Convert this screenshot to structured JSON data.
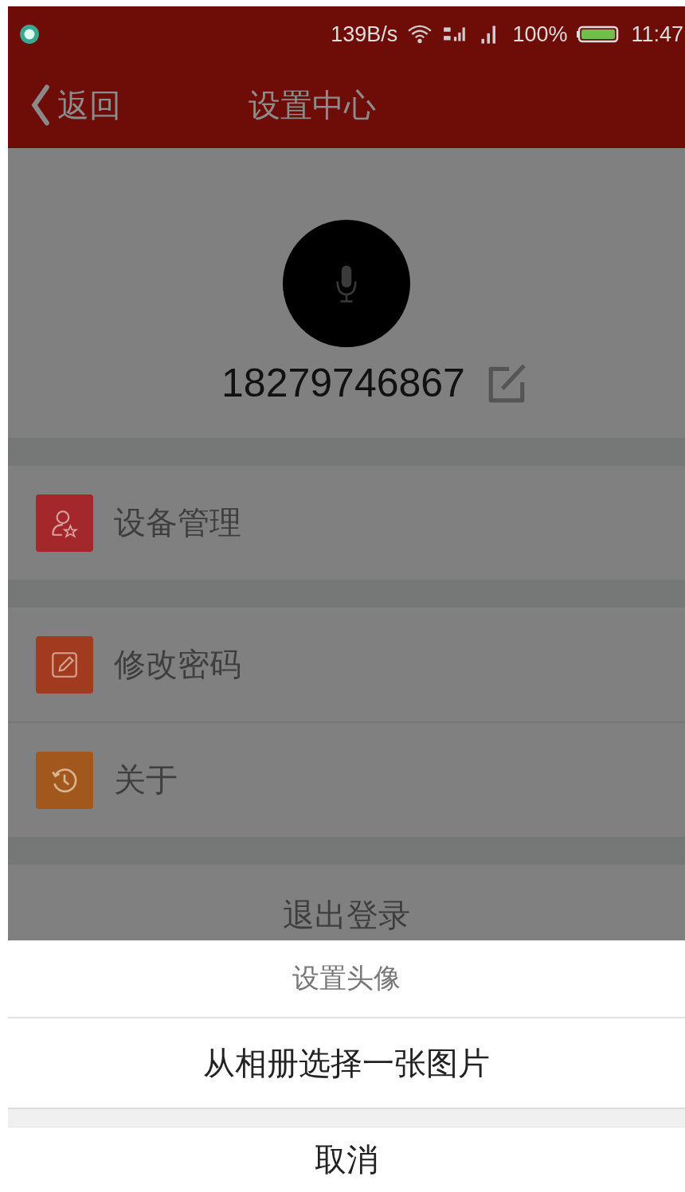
{
  "status_bar": {
    "network_speed": "139B/s",
    "battery": "100%",
    "time": "11:47"
  },
  "nav": {
    "back": "返回",
    "title": "设置中心"
  },
  "profile": {
    "phone": "18279746867"
  },
  "menu": [
    {
      "label": "设备管理",
      "kind": "user",
      "color": "#a3272b"
    },
    {
      "label": "修改密码",
      "kind": "edit",
      "color": "#a13a1e"
    },
    {
      "label": "关于",
      "kind": "history",
      "color": "#a2581c"
    }
  ],
  "logout": "退出登录",
  "action_sheet": {
    "title": "设置头像",
    "options": [
      "从相册选择一张图片"
    ],
    "cancel": "取消"
  }
}
